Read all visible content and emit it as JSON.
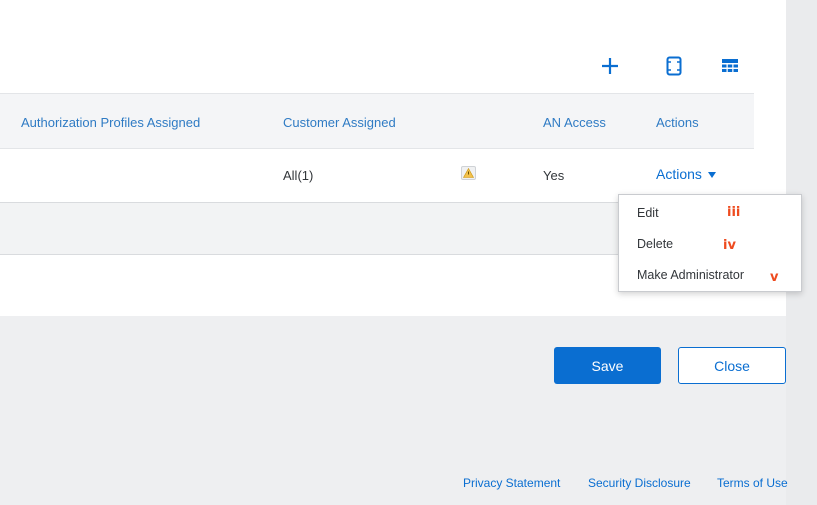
{
  "toolbar": {
    "add_icon": "plus-icon",
    "export_icon": "page-icon",
    "table_settings_icon": "table-icon"
  },
  "table": {
    "columns": [
      "Authorization Profiles Assigned",
      "Customer Assigned",
      "AN Access",
      "Actions"
    ],
    "rows": [
      {
        "customer_assigned": "All(1)",
        "an_access": "Yes",
        "actions_label": "Actions"
      }
    ]
  },
  "actions_menu": {
    "items": [
      {
        "label": "Edit",
        "marker": "iii"
      },
      {
        "label": "Delete",
        "marker": "iv"
      },
      {
        "label": "Make Administrator",
        "marker": "v"
      }
    ]
  },
  "buttons": {
    "save": "Save",
    "close": "Close"
  },
  "footer": {
    "links": [
      "Privacy Statement",
      "Security Disclosure",
      "Terms of Use"
    ]
  },
  "colors": {
    "accent": "#0a6ed1",
    "header_text": "#2f7bc4",
    "marker": "#ee4b1f",
    "page_bg": "#eeeff1"
  }
}
